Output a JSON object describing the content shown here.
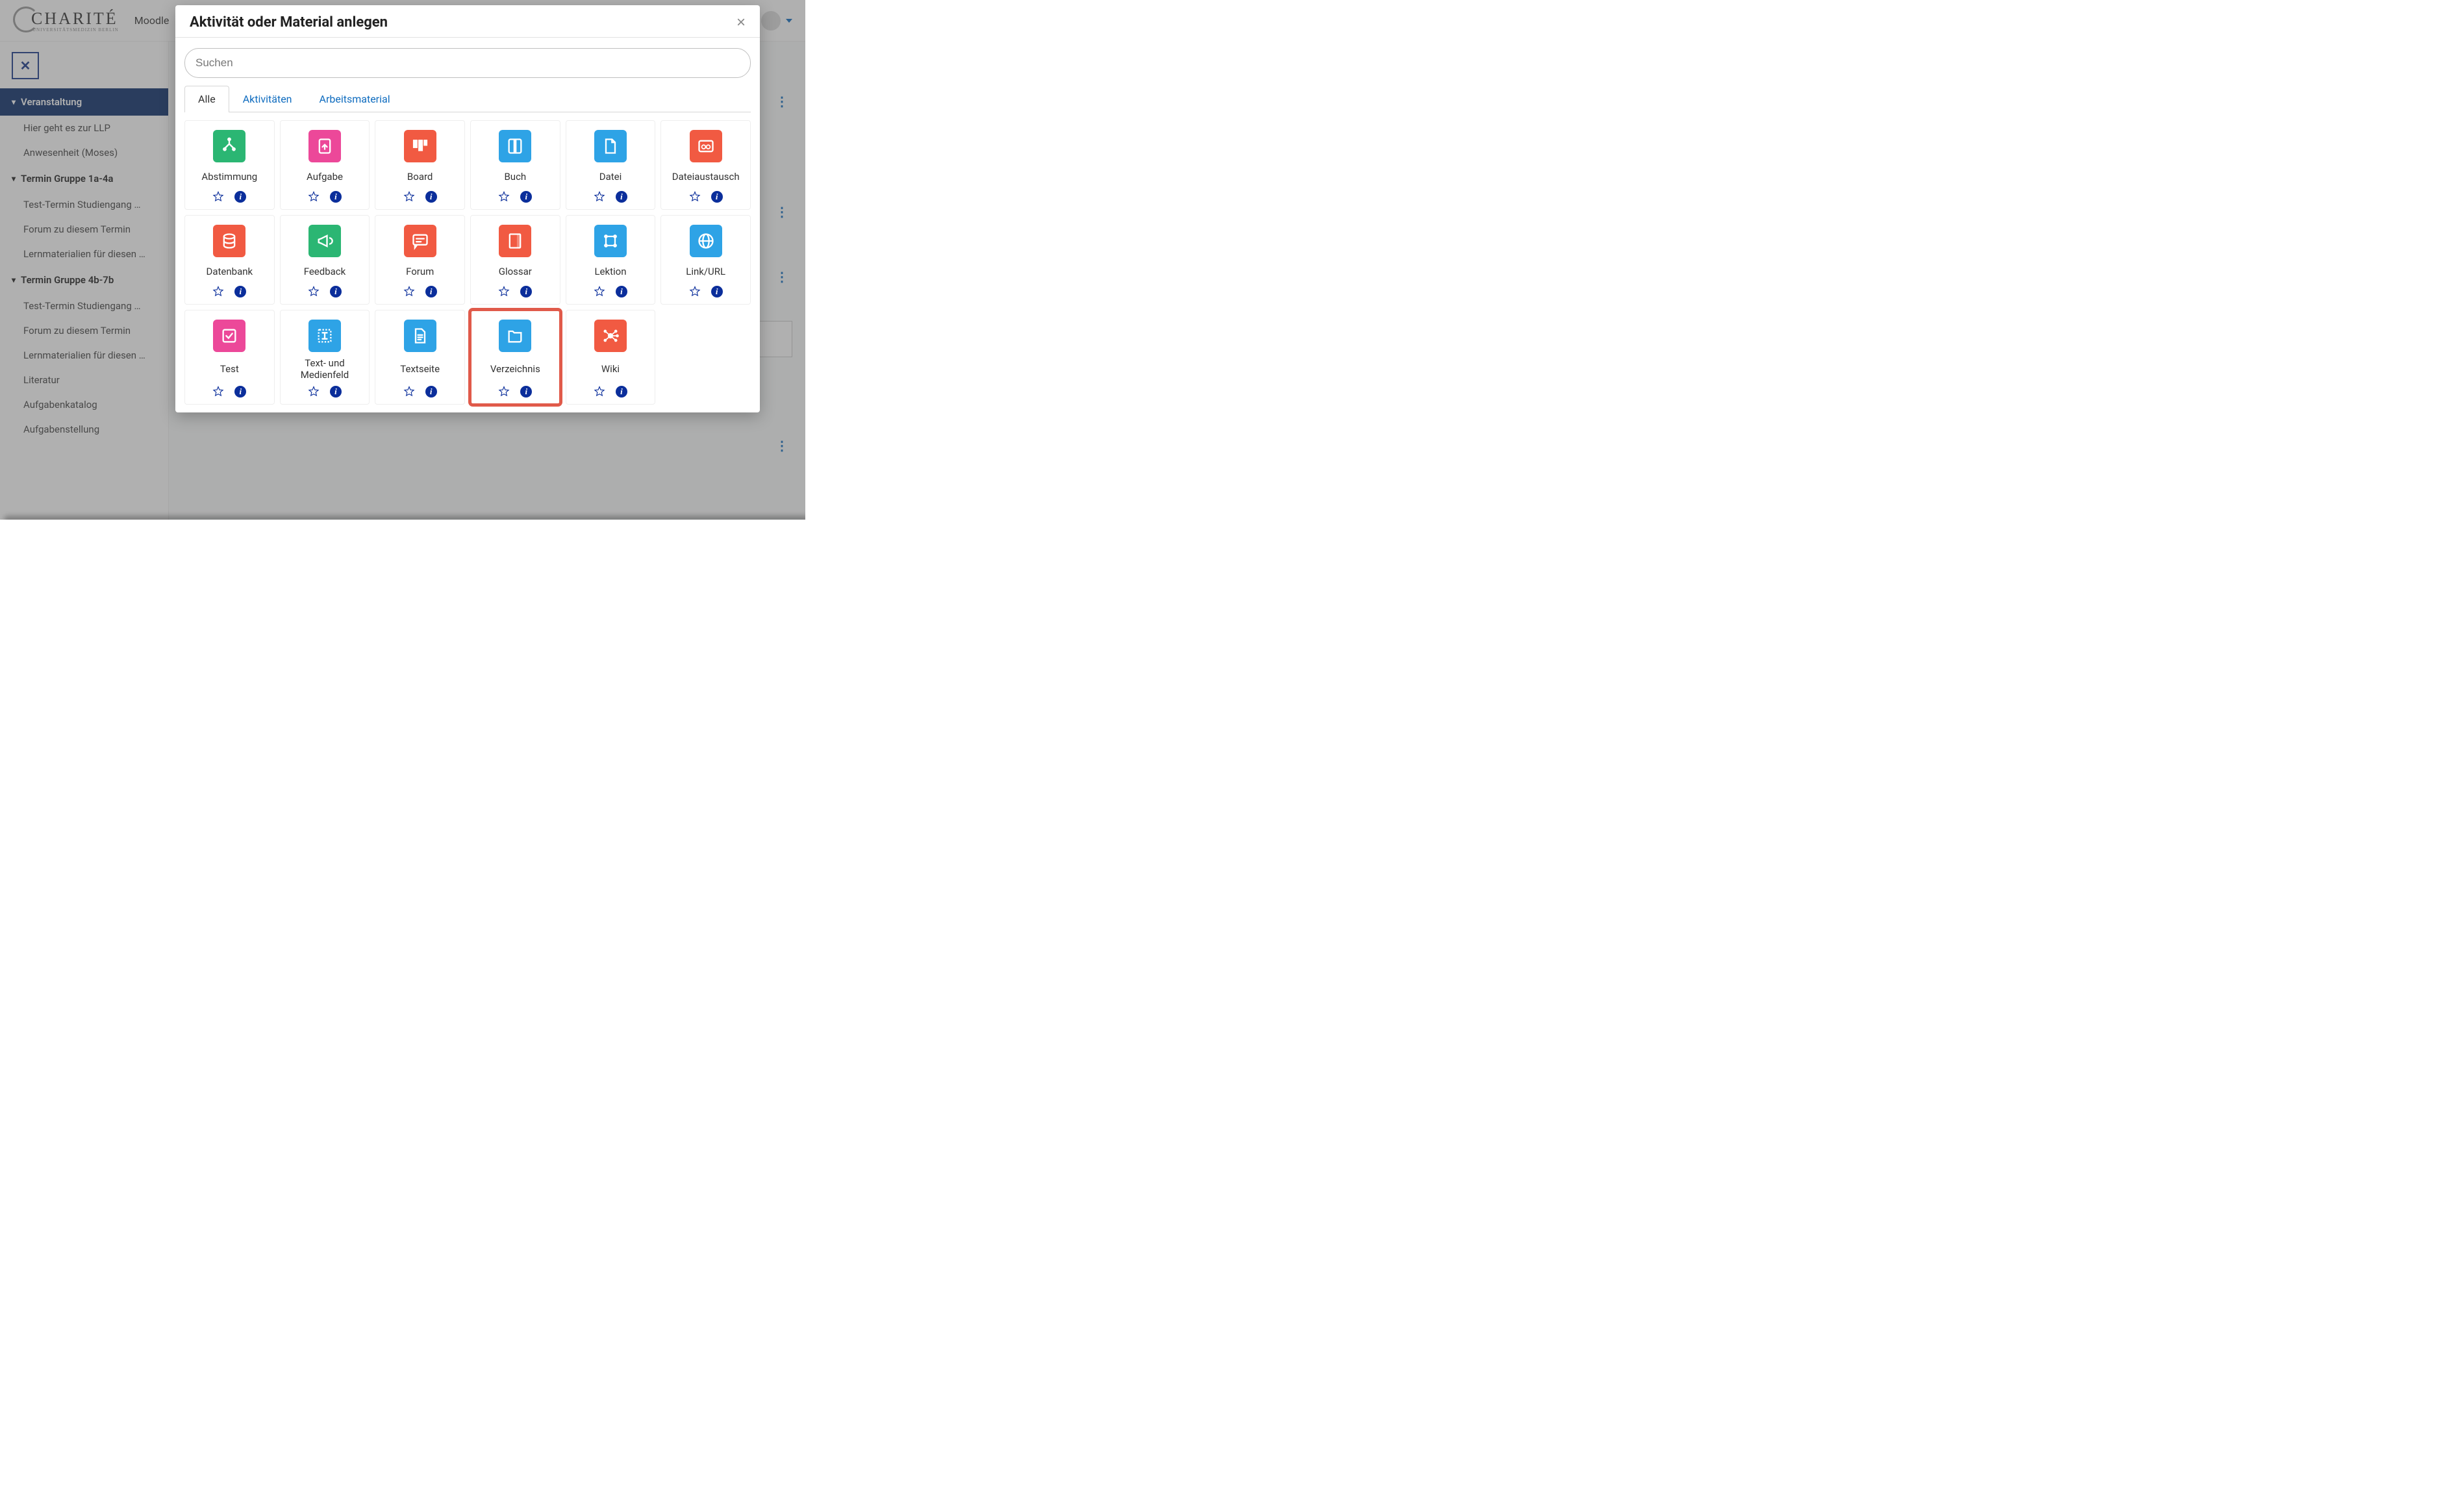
{
  "brand": {
    "name": "CHARITÉ",
    "sub": "UNIVERSITÄTSMEDIZIN BERLIN"
  },
  "topnav": {
    "moodle": "Moodle"
  },
  "sidebar": {
    "sections": [
      {
        "title": "Veranstaltung",
        "active": true,
        "items": [
          "Hier geht es zur LLP",
          "Anwesenheit (Moses)"
        ]
      },
      {
        "title": "Termin Gruppe 1a-4a",
        "active": false,
        "items": [
          "Test-Termin Studiengang …",
          "Forum zu diesem Termin",
          "Lernmaterialien für diesen …"
        ]
      },
      {
        "title": "Termin Gruppe 4b-7b",
        "active": false,
        "items": [
          "Test-Termin Studiengang …",
          "Forum zu diesem Termin",
          "Lernmaterialien für diesen …",
          "Literatur",
          "Aufgabenkatalog",
          "Aufgabenstellung"
        ]
      }
    ]
  },
  "modal": {
    "title": "Aktivität oder Material anlegen",
    "search_placeholder": "Suchen",
    "tabs": {
      "all": "Alle",
      "activities": "Aktivitäten",
      "resources": "Arbeitsmaterial"
    },
    "items": [
      {
        "key": "abstimmung",
        "label": "Abstimmung",
        "color": "green",
        "icon": "branch"
      },
      {
        "key": "aufgabe",
        "label": "Aufgabe",
        "color": "pink",
        "icon": "upload-doc"
      },
      {
        "key": "board",
        "label": "Board",
        "color": "orange",
        "icon": "board"
      },
      {
        "key": "buch",
        "label": "Buch",
        "color": "blue",
        "icon": "book"
      },
      {
        "key": "datei",
        "label": "Datei",
        "color": "blue",
        "icon": "file"
      },
      {
        "key": "dateiaustausch",
        "label": "Dateiaustausch",
        "color": "orange",
        "icon": "exchange"
      },
      {
        "key": "datenbank",
        "label": "Datenbank",
        "color": "orange",
        "icon": "database"
      },
      {
        "key": "feedback",
        "label": "Feedback",
        "color": "green",
        "icon": "megaphone"
      },
      {
        "key": "forum",
        "label": "Forum",
        "color": "orange",
        "icon": "chat"
      },
      {
        "key": "glossar",
        "label": "Glossar",
        "color": "orange",
        "icon": "glossary"
      },
      {
        "key": "lektion",
        "label": "Lektion",
        "color": "blue",
        "icon": "path"
      },
      {
        "key": "link",
        "label": "Link/URL",
        "color": "blue",
        "icon": "globe"
      },
      {
        "key": "test",
        "label": "Test",
        "color": "pink",
        "icon": "check-sq"
      },
      {
        "key": "textfeld",
        "label": "Text- und Medienfeld",
        "color": "blue",
        "icon": "textbox"
      },
      {
        "key": "textseite",
        "label": "Textseite",
        "color": "blue",
        "icon": "textpage"
      },
      {
        "key": "verzeichnis",
        "label": "Verzeichnis",
        "color": "blue",
        "icon": "folder",
        "highlight": true
      },
      {
        "key": "wiki",
        "label": "Wiki",
        "color": "orange",
        "icon": "wiki"
      }
    ]
  }
}
